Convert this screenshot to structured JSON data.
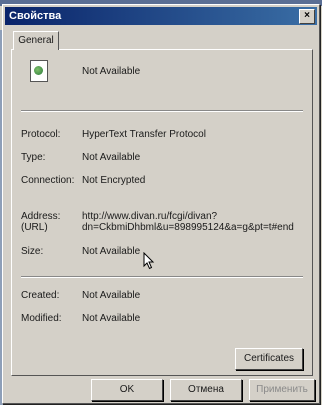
{
  "window": {
    "title": "Свойства",
    "close_glyph": "×"
  },
  "tab": {
    "label": "General"
  },
  "header": {
    "value": "Not Available"
  },
  "properties": {
    "protocol": {
      "label": "Protocol:",
      "value": "HyperText Transfer Protocol"
    },
    "type": {
      "label": "Type:",
      "value": "Not Available"
    },
    "connection": {
      "label": "Connection:",
      "value": "Not Encrypted"
    },
    "address": {
      "label": "Address:",
      "label2": "(URL)",
      "value": "http://www.divan.ru/fcgi/divan?",
      "value2": "dn=CkbmiDhbml&u=898995124&a=g&pt=t#end"
    },
    "size": {
      "label": "Size:",
      "value": "Not Available"
    },
    "created": {
      "label": "Created:",
      "value": "Not Available"
    },
    "modified": {
      "label": "Modified:",
      "value": "Not Available"
    }
  },
  "buttons": {
    "certificates": "Certificates",
    "ok": "OK",
    "cancel": "Отмена",
    "apply": "Применить"
  },
  "icons": [
    "document-icon",
    "close-icon",
    "mouse-cursor-icon"
  ]
}
